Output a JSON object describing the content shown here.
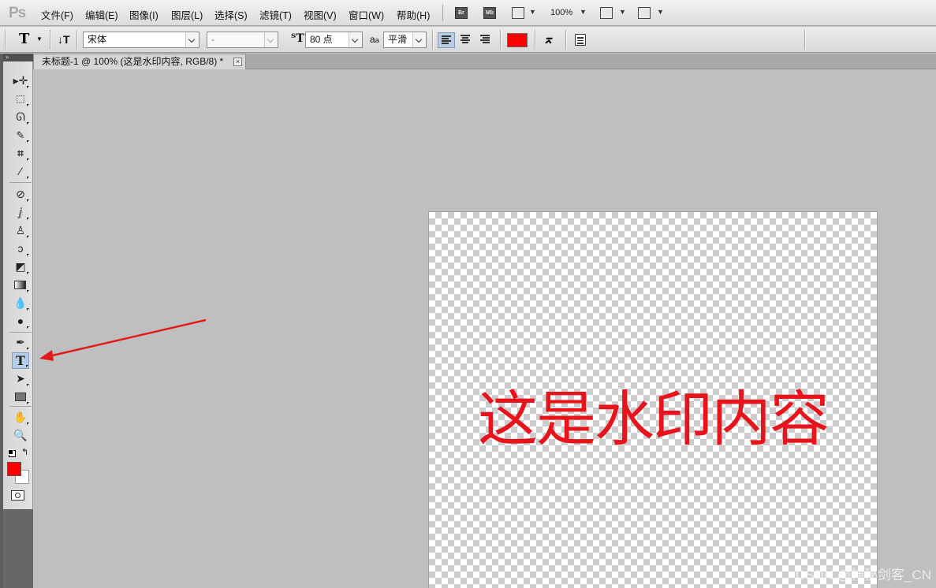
{
  "app": {
    "logo": "Ps"
  },
  "menu": [
    "文件(F)",
    "编辑(E)",
    "图像(I)",
    "图层(L)",
    "选择(S)",
    "滤镜(T)",
    "视图(V)",
    "窗口(W)",
    "帮助(H)"
  ],
  "menubar_extras": {
    "bridge_icon": "Br",
    "minibridge_icon": "Mb",
    "zoom_level": "100%"
  },
  "options": {
    "tool_glyph": "T",
    "font_family": "宋体",
    "font_style": "-",
    "font_size": "80 点",
    "antialias_label": "a",
    "antialias_value": "平滑",
    "text_color": "#ff0000"
  },
  "document": {
    "tab_title": "未标题-1 @ 100% (这是水印内容, RGB/8) *",
    "close_glyph": "×",
    "text_layer_content": "这是水印内容",
    "text_layer_color": "#e8141c"
  },
  "toolbox": {
    "header": "»",
    "type_tool_glyph": "T",
    "foreground_color": "#ff0000",
    "background_color": "#ffffff"
  },
  "annotation": {
    "arrow_color": "#e21a1a"
  },
  "watermark": "CSDN @神秘剑客_CN"
}
